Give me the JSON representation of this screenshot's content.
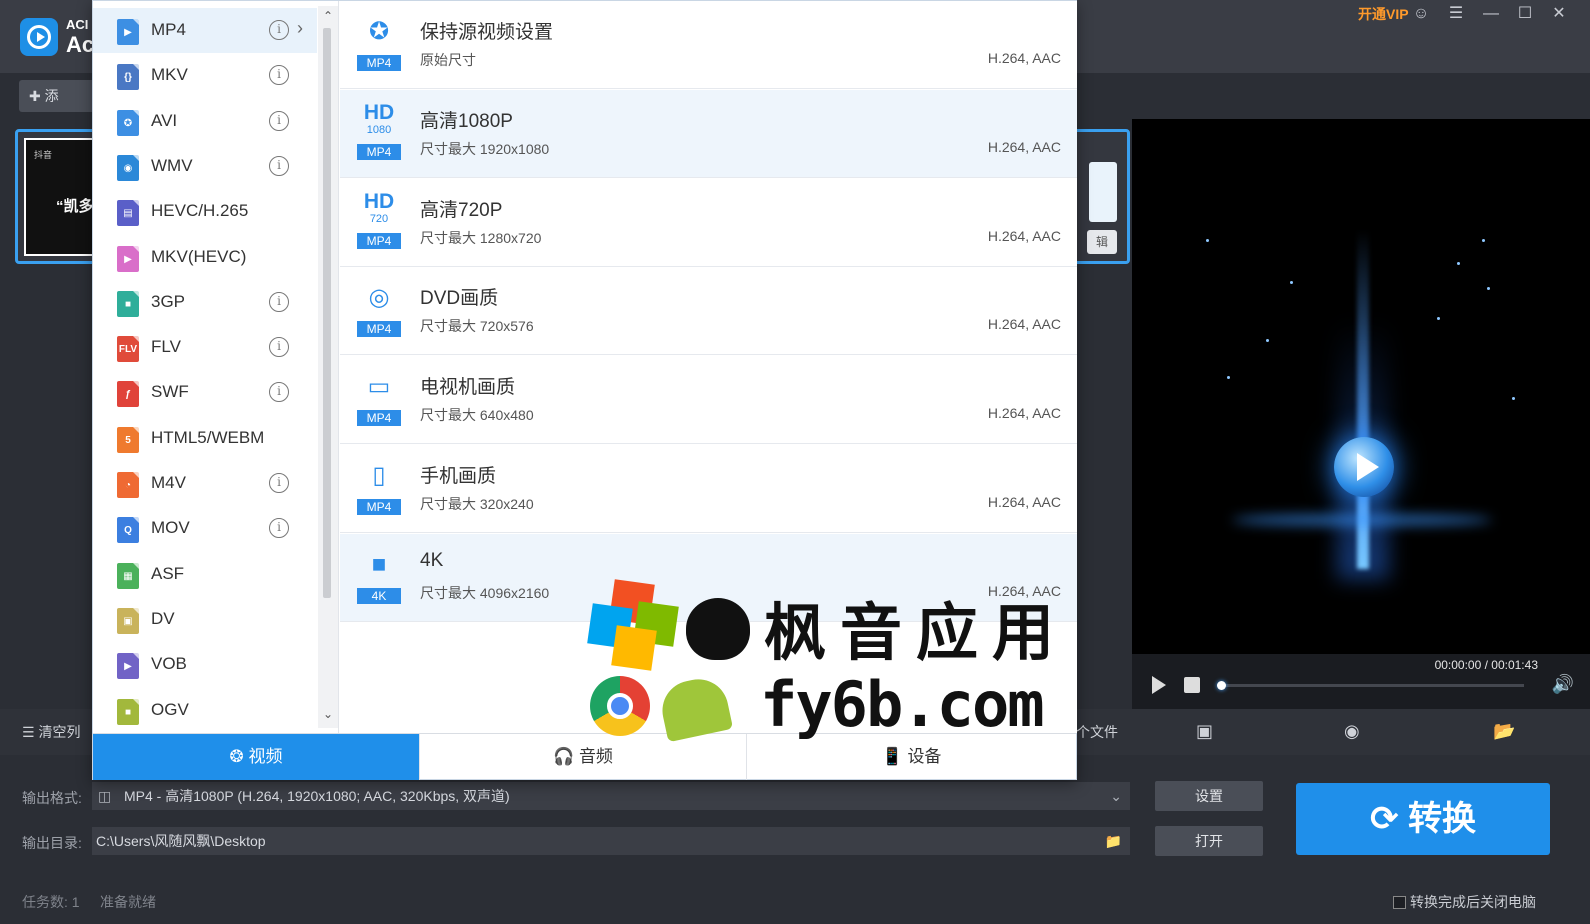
{
  "app": {
    "name_line1": "ACI",
    "name_line2": "Ac",
    "vip_label": "开通VIP",
    "add_label": "添"
  },
  "file": {
    "thumb_tag": "抖音",
    "thumb_caption": "“凯多",
    "edit_label": "辑"
  },
  "player": {
    "time": "00:00:00 / 00:01:43",
    "progress": 0.0
  },
  "list_bar": {
    "clear_label": "清空列",
    "add_file_label": "个文件"
  },
  "formats": [
    {
      "name": "MP4",
      "icon": "play",
      "color": "#3d8fe3",
      "info": true,
      "selected": true
    },
    {
      "name": "MKV",
      "icon": "{}",
      "color": "#4a78c4",
      "info": true
    },
    {
      "name": "AVI",
      "icon": "reel",
      "color": "#3d8fe3",
      "info": true
    },
    {
      "name": "WMV",
      "icon": "play-circle",
      "color": "#2b88d8",
      "info": true
    },
    {
      "name": "HEVC/H.265",
      "icon": "film",
      "color": "#5a5fc8",
      "info": false
    },
    {
      "name": "MKV(HEVC)",
      "icon": "play",
      "color": "#d96ec9",
      "info": false
    },
    {
      "name": "3GP",
      "icon": "camera",
      "color": "#2fae9a",
      "info": true
    },
    {
      "name": "FLV",
      "icon": "FLV",
      "color": "#e04b3a",
      "info": true
    },
    {
      "name": "SWF",
      "icon": "flash",
      "color": "#e0433a",
      "info": true
    },
    {
      "name": "HTML5/WEBM",
      "icon": "5",
      "color": "#ef7a2e",
      "info": false
    },
    {
      "name": "M4V",
      "icon": "pie",
      "color": "#ef6a33",
      "info": true
    },
    {
      "name": "MOV",
      "icon": "q",
      "color": "#3c7fe0",
      "info": true
    },
    {
      "name": "ASF",
      "icon": "clapper",
      "color": "#4bb15b",
      "info": false
    },
    {
      "name": "DV",
      "icon": "dv",
      "color": "#c9b35b",
      "info": false
    },
    {
      "name": "VOB",
      "icon": "play",
      "color": "#7163c6",
      "info": false
    },
    {
      "name": "OGV",
      "icon": "camera",
      "color": "#a2b83c",
      "info": false
    }
  ],
  "presets": [
    {
      "title": "保持源视频设置",
      "sub": "原始尺寸",
      "codec": "H.264, AAC",
      "glyph": "reel",
      "badge": "MP4",
      "highlight": false
    },
    {
      "title": "高清1080P",
      "sub": "尺寸最大 1920x1080",
      "codec": "H.264, AAC",
      "glyph": "HD",
      "glyph_sub": "1080",
      "badge": "MP4",
      "highlight": true
    },
    {
      "title": "高清720P",
      "sub": "尺寸最大 1280x720",
      "codec": "H.264, AAC",
      "glyph": "HD",
      "glyph_sub": "720",
      "badge": "MP4",
      "highlight": false
    },
    {
      "title": "DVD画质",
      "sub": "尺寸最大 720x576",
      "codec": "H.264, AAC",
      "glyph": "disc",
      "badge": "MP4",
      "highlight": false
    },
    {
      "title": "电视机画质",
      "sub": "尺寸最大 640x480",
      "codec": "H.264, AAC",
      "glyph": "tv",
      "badge": "MP4",
      "highlight": false
    },
    {
      "title": "手机画质",
      "sub": "尺寸最大 320x240",
      "codec": "H.264, AAC",
      "glyph": "phone",
      "badge": "MP4",
      "highlight": false
    },
    {
      "title": "4K",
      "sub": "尺寸最大 4096x2160",
      "codec": "H.264, AAC",
      "glyph": "camera",
      "badge": "4K",
      "highlight": true
    }
  ],
  "tabs": {
    "video": "视频",
    "audio": "音频",
    "device": "设备"
  },
  "output": {
    "format_label": "输出格式:",
    "format_value": "MP4 - 高清1080P (H.264, 1920x1080; AAC, 320Kbps, 双声道)",
    "dir_label": "输出目录:",
    "dir_value": "C:\\Users\\风随风飘\\Desktop",
    "settings_btn": "设置",
    "open_btn": "打开",
    "convert_btn": "转换"
  },
  "status": {
    "tasks": "任务数: 1",
    "ready": "准备就绪",
    "shutdown": "转换完成后关闭电脑"
  },
  "watermark": {
    "cn": "枫音应用",
    "en": "fy6b.com"
  }
}
